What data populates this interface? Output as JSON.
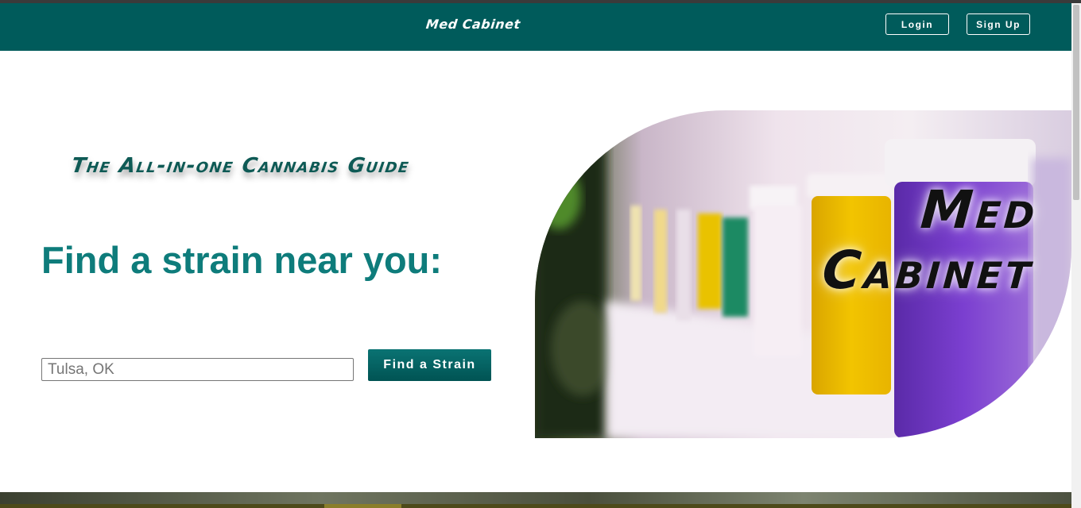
{
  "navbar": {
    "brand": "Med Cabinet",
    "login_label": "Login",
    "signup_label": "Sign Up"
  },
  "main": {
    "tagline": "The All-in-one Cannabis Guide",
    "heading": "Find a strain near you:",
    "search": {
      "placeholder": "Tulsa, OK",
      "value": ""
    },
    "find_button_label": "Find a Strain"
  },
  "hero": {
    "title_line1": "Med",
    "title_line2": "Cabinet"
  },
  "colors": {
    "nav_background": "#005b5b",
    "heading_text": "#0e7c7b",
    "button_background": "#006b6b"
  }
}
